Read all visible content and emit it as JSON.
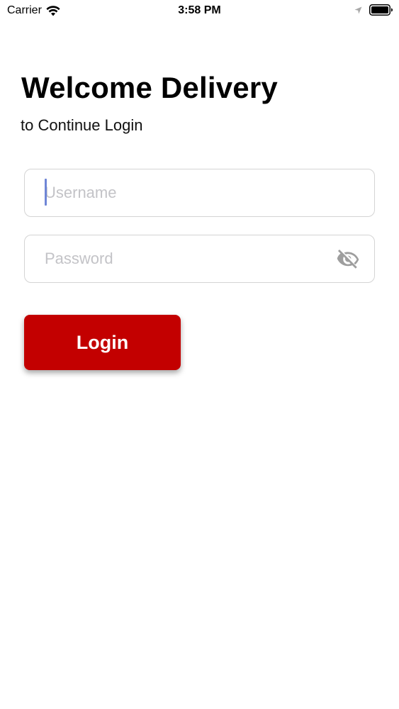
{
  "status_bar": {
    "carrier": "Carrier",
    "time": "3:58 PM",
    "icons": [
      "wifi-icon",
      "location-icon",
      "battery-icon"
    ]
  },
  "header": {
    "title": "Welcome Delivery",
    "subtitle": "to Continue Login"
  },
  "form": {
    "username": {
      "value": "",
      "placeholder": "Username"
    },
    "password": {
      "value": "",
      "placeholder": "Password",
      "toggle_icon": "eye-off-icon"
    },
    "login_label": "Login"
  },
  "colors": {
    "accent": "#c30000",
    "field_border": "#d4d4d4",
    "placeholder": "#c3c3c7",
    "caret": "#6f86d6"
  }
}
